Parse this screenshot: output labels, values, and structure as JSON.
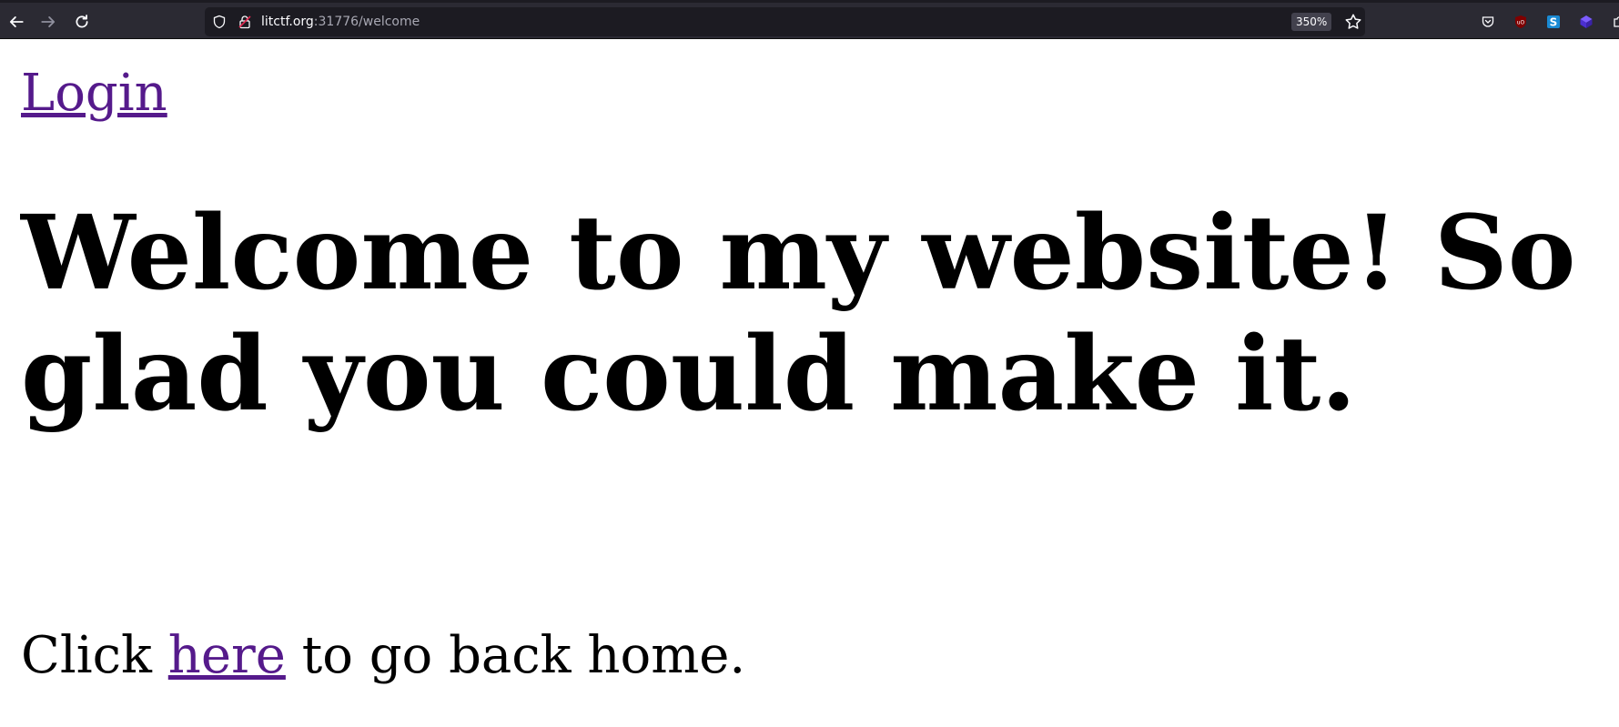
{
  "browser": {
    "url_host": "litctf.org",
    "url_path": ":31776/welcome",
    "zoom": "350%",
    "extensions": [
      "pocket-icon",
      "ublock-origin-icon",
      "s-extension-icon",
      "cube-extension-icon"
    ]
  },
  "page": {
    "login_link": "Login",
    "heading": "Welcome to my website! So glad you could make it.",
    "back_prefix": "Click ",
    "back_link": "here",
    "back_suffix": " to go back home.",
    "link_color": "#551a8b"
  },
  "colors": {
    "toolbar_bg": "#2b2a33",
    "urlbar_bg": "#1c1b22",
    "page_bg": "#ffffff"
  }
}
